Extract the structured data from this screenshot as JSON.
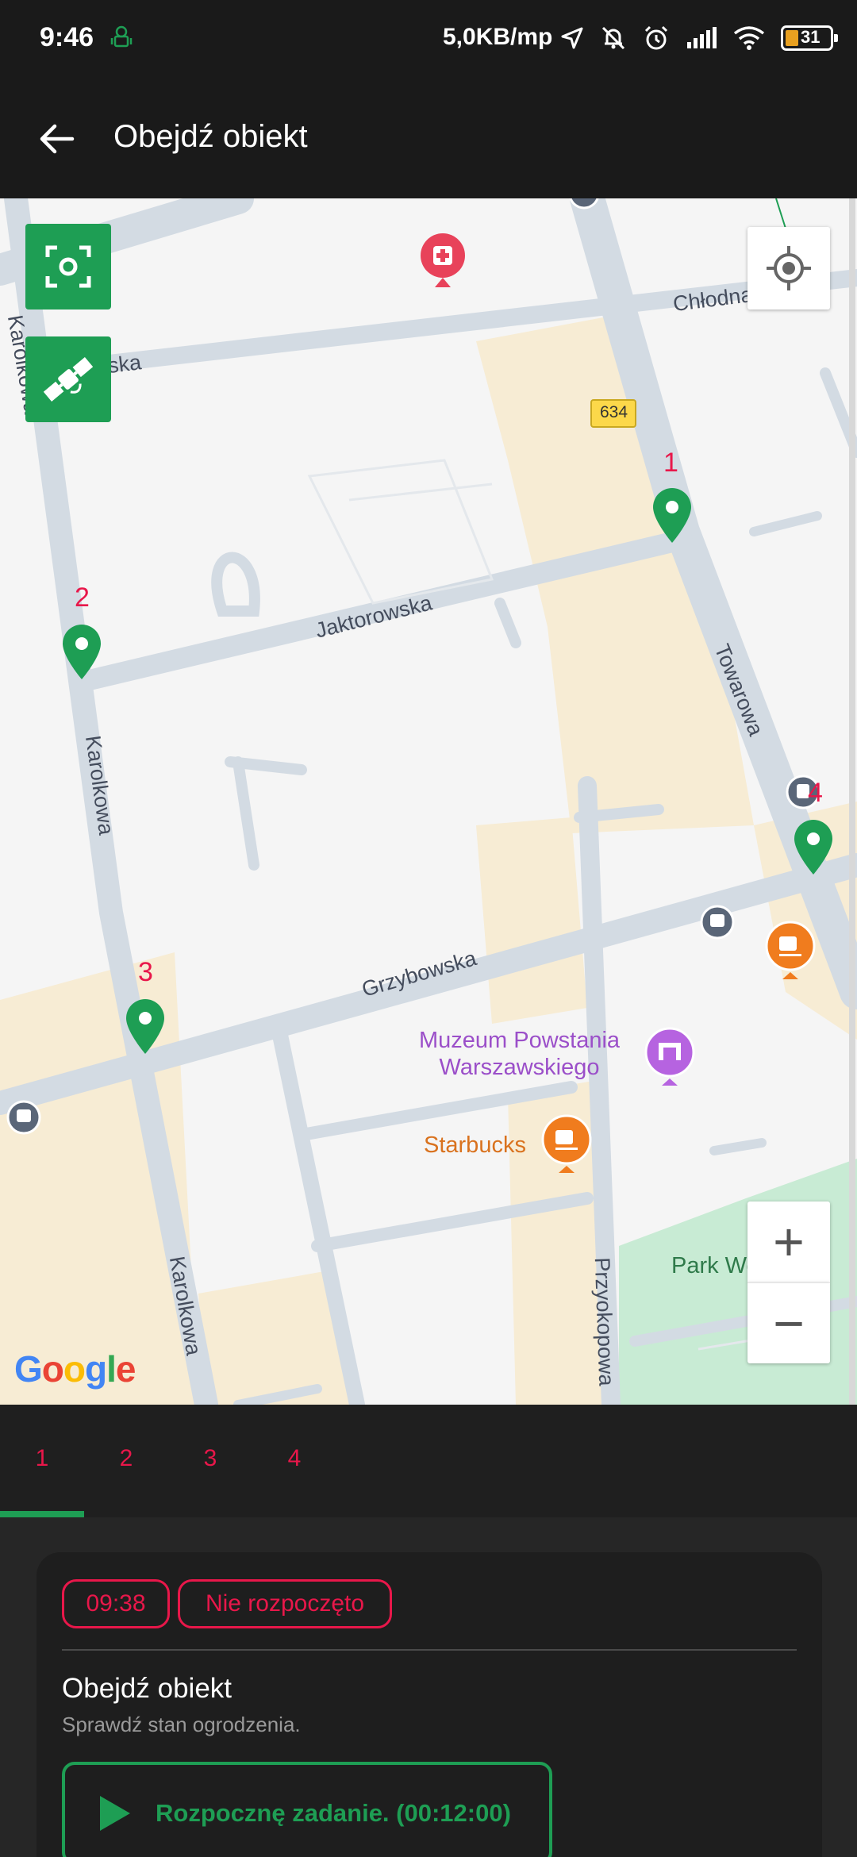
{
  "status": {
    "time": "9:46",
    "net_speed": "5,0KB/mp",
    "battery": "31",
    "icons": [
      "android-robot-icon",
      "location-arrow-icon",
      "bell-off-icon",
      "alarm-icon",
      "signal-icon",
      "wifi-icon",
      "battery-icon"
    ]
  },
  "appbar": {
    "title": "Obejdź obiekt",
    "back_icon": "arrow-left-icon"
  },
  "map": {
    "streets": {
      "chlodna": "Chłodna",
      "lska": "lska",
      "karolkowa_top": "Karolkowa",
      "road_number": "634",
      "jaktorowska": "Jaktorowska",
      "towarowa": "Towarowa",
      "karolkowa_mid": "Karolkowa",
      "grzybowska": "Grzybowska",
      "karolkowa_bottom": "Karolkowa",
      "przyokopowa": "Przyokopowa"
    },
    "pois": {
      "museum_line1": "Muzeum Powstania",
      "museum_line2": "Warszawskiego",
      "starbucks": "Starbucks",
      "park": "Park Wolności"
    },
    "markers": [
      {
        "number": "1"
      },
      {
        "number": "2"
      },
      {
        "number": "3"
      },
      {
        "number": "4"
      }
    ],
    "google": "Google",
    "zoom_in": "+",
    "zoom_out": "−",
    "colors": {
      "marker": "#1e9e54",
      "marker_label": "#e8174a",
      "road": "#d3dbe3",
      "block": "#f7ecd4",
      "park": "#c8ebd4"
    }
  },
  "tabs": [
    {
      "label": "1",
      "selected": true
    },
    {
      "label": "2",
      "selected": false
    },
    {
      "label": "3",
      "selected": false
    },
    {
      "label": "4",
      "selected": false
    }
  ],
  "task": {
    "time_chip": "09:38",
    "status_chip": "Nie rozpoczęto",
    "title": "Obejdź obiekt",
    "description": "Sprawdź stan ogrodzenia.",
    "start_button": "Rozpocznę zadanie. (00:12:00)"
  },
  "colors": {
    "accent_green": "#1e9e54",
    "accent_red": "#e8174a",
    "background": "#222222"
  }
}
